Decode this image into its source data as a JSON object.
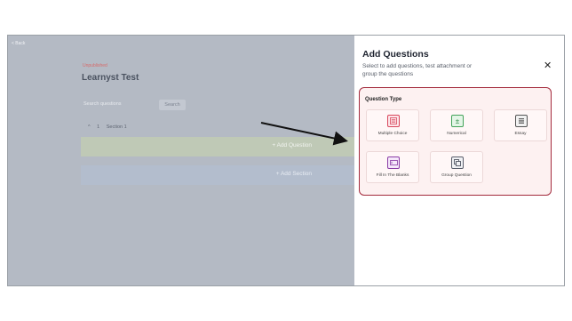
{
  "builder": {
    "back_label": "< Back",
    "status": "Unpublished",
    "title": "Learnyst Test",
    "search_placeholder": "Search questions",
    "search_button": "Search",
    "section_toggle": "^",
    "section_number": "1",
    "section_name": "Section 1",
    "add_question": "+  Add Question",
    "add_section": "+  Add Section"
  },
  "panel": {
    "title": "Add Questions",
    "subtitle": "Select to add questions, test attachment or group the questions",
    "close_icon": "close-icon",
    "question_type_label": "Question Type",
    "types": [
      {
        "label": "Multiple Choice",
        "icon": "list-icon",
        "color": "#d8485c"
      },
      {
        "label": "Numerical",
        "icon": "plus-minus-icon",
        "color": "#44a35a"
      },
      {
        "label": "Essay",
        "icon": "essay-icon",
        "color": "#555555"
      },
      {
        "label": "Fill In The Blanks",
        "icon": "blank-icon",
        "color": "#8a3ca6"
      },
      {
        "label": "Group Question",
        "icon": "group-icon",
        "color": "#5a5f6c"
      }
    ]
  },
  "colors": {
    "accent_border": "#a32a3c",
    "overlay": "#b4bac4"
  }
}
